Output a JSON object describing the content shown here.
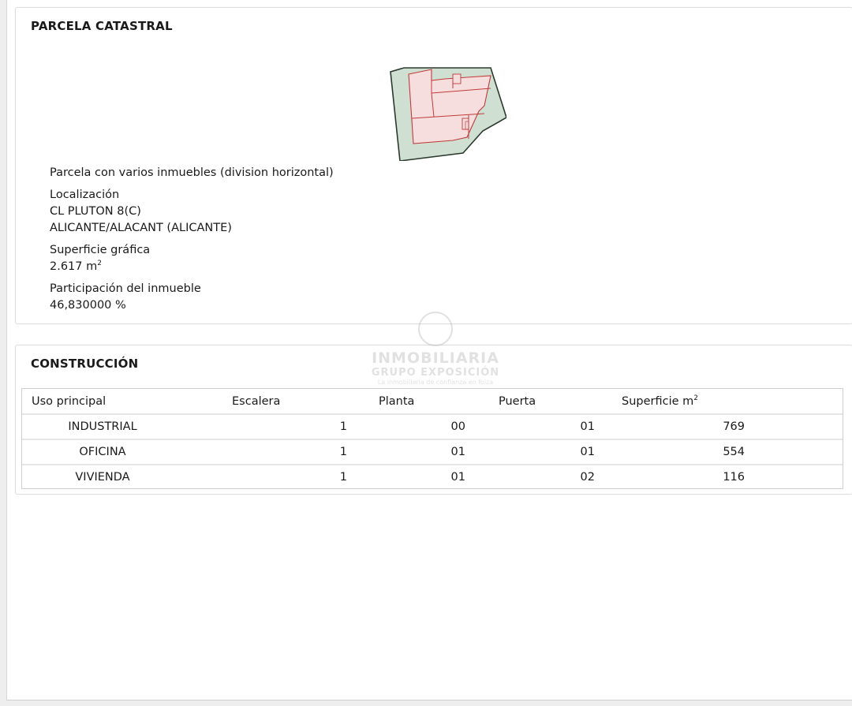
{
  "parcela": {
    "title": "PARCELA CATASTRAL",
    "description": "Parcela con varios inmuebles (division horizontal)",
    "localizacion_label": "Localización",
    "address_line1": "CL PLUTON 8(C)",
    "address_line2": "ALICANTE/ALACANT (ALICANTE)",
    "superficie_label": "Superficie gráfica",
    "superficie_value": "2.617 m",
    "superficie_exp": "2",
    "participacion_label": "Participación del inmueble",
    "participacion_value": "46,830000 %"
  },
  "construccion": {
    "title": "CONSTRUCCIÓN",
    "headers": {
      "uso": "Uso principal",
      "escalera": "Escalera",
      "planta": "Planta",
      "puerta": "Puerta",
      "superficie": "Superficie m",
      "superficie_exp": "2"
    },
    "rows": [
      {
        "uso": "INDUSTRIAL",
        "escalera": "1",
        "planta": "00",
        "puerta": "01",
        "superficie": "769"
      },
      {
        "uso": "OFICINA",
        "escalera": "1",
        "planta": "01",
        "puerta": "01",
        "superficie": "554"
      },
      {
        "uso": "VIVIENDA",
        "escalera": "1",
        "planta": "01",
        "puerta": "02",
        "superficie": "116"
      }
    ]
  },
  "watermark": {
    "line1": "INMOBILIARIA",
    "line2": "GRUPO EXPOSICIÓN",
    "line3": "La inmobiliaria de confianza en Ibiza"
  }
}
